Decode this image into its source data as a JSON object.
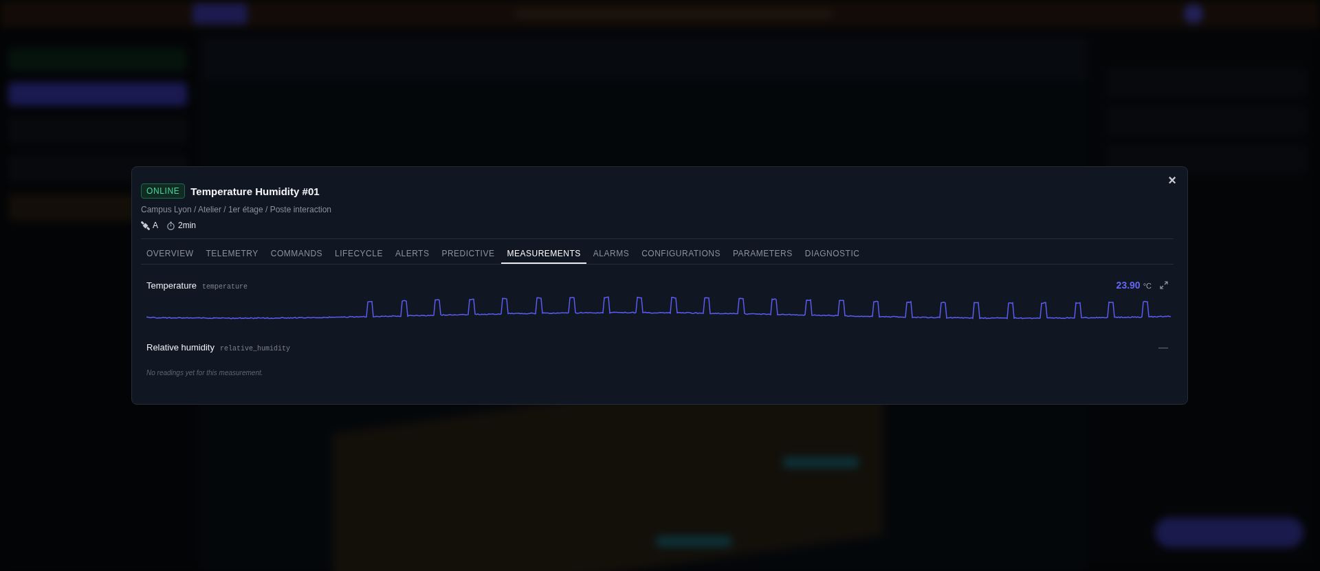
{
  "modal": {
    "status": "ONLINE",
    "title": "Temperature Humidity #01",
    "path": "Campus Lyon / Atelier / 1er étage / Poste interaction",
    "meta": [
      {
        "kind": "signal",
        "text": "A"
      },
      {
        "kind": "timer",
        "text": "2min"
      }
    ],
    "close": "×"
  },
  "tabs": [
    {
      "label": "OVERVIEW",
      "selected": false
    },
    {
      "label": "TELEMETRY",
      "selected": false
    },
    {
      "label": "COMMANDS",
      "selected": false
    },
    {
      "label": "LIFECYCLE",
      "selected": false
    },
    {
      "label": "ALERTS",
      "selected": false
    },
    {
      "label": "PREDICTIVE",
      "selected": false
    },
    {
      "label": "MEASUREMENTS",
      "selected": true
    },
    {
      "label": "ALARMS",
      "selected": false
    },
    {
      "label": "CONFIGURATIONS",
      "selected": false
    },
    {
      "label": "PARAMETERS",
      "selected": false
    },
    {
      "label": "DIAGNOSTIC",
      "selected": false
    }
  ],
  "measurements": [
    {
      "kind": "chart",
      "name": "Temperature",
      "key": "temperature",
      "value": "23.90",
      "unit": "°C"
    },
    {
      "kind": "empty",
      "name": "Relative humidity",
      "key": "relative_humidity",
      "value": "—",
      "empty_text": "No readings yet for this measurement."
    }
  ]
}
